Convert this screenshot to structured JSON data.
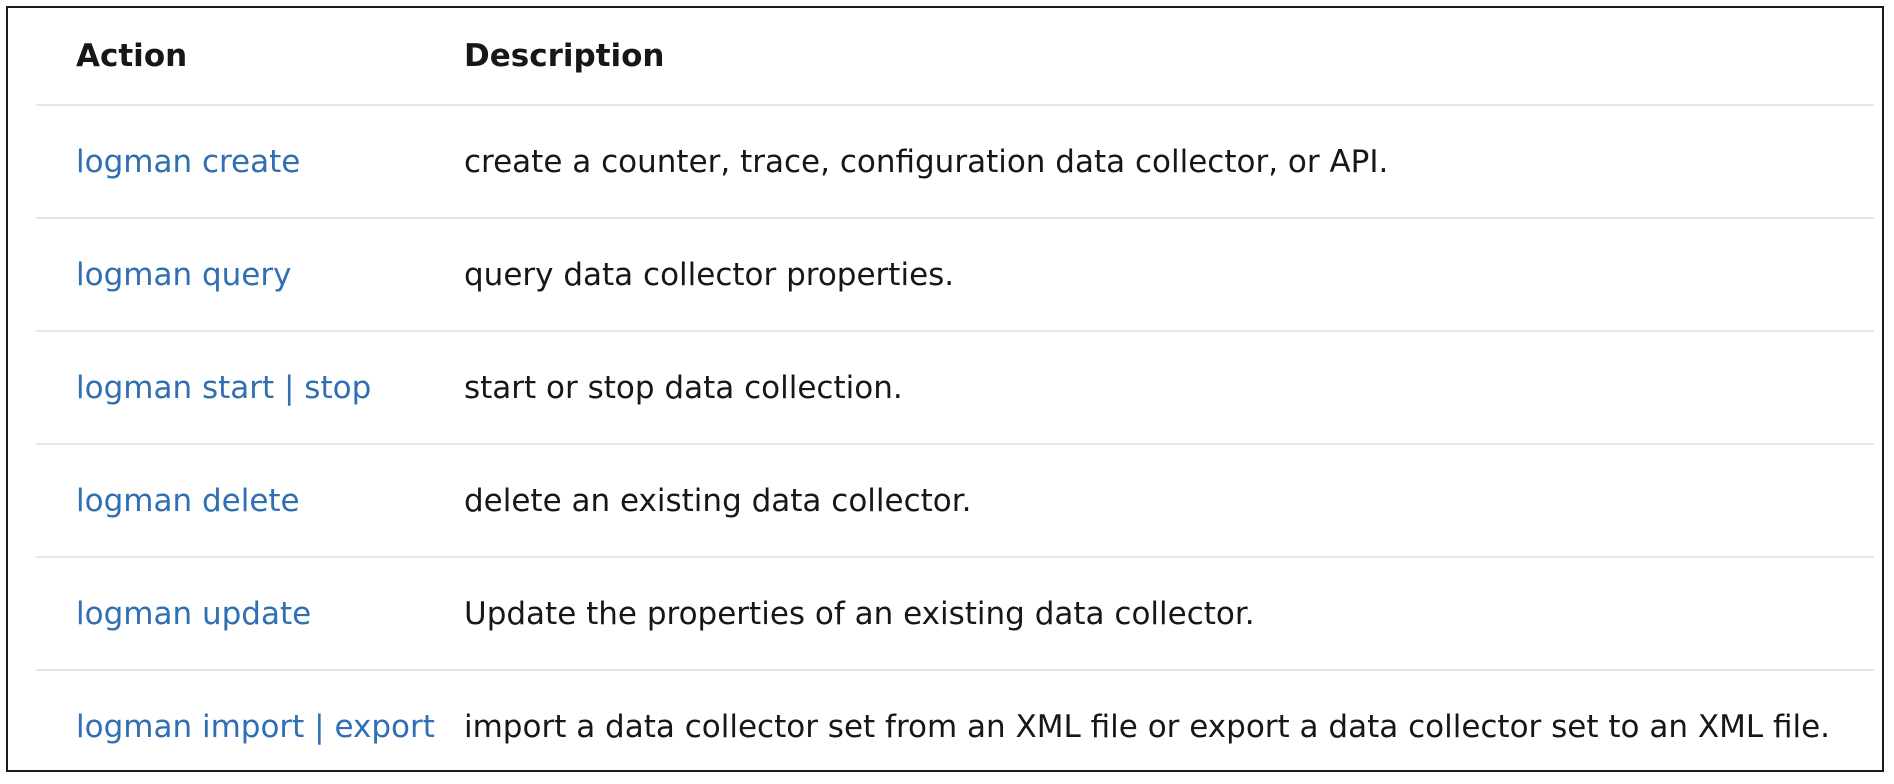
{
  "table": {
    "headers": {
      "action": "Action",
      "description": "Description"
    },
    "rows": [
      {
        "action": "logman create",
        "description": "create a counter, trace, configuration data collector, or API."
      },
      {
        "action": "logman query",
        "description": "query data collector properties."
      },
      {
        "action": "logman start | stop",
        "description": "start or stop data collection."
      },
      {
        "action": "logman delete",
        "description": "delete an existing data collector."
      },
      {
        "action": "logman update",
        "description": "Update the properties of an existing data collector."
      },
      {
        "action": "logman import | export",
        "description": "import a data collector set from an XML file or export a data collector set to an XML file."
      }
    ]
  },
  "colors": {
    "link": "#2f6fb2",
    "text": "#171717",
    "divider": "#e6e6e6",
    "border": "#1a1a1a"
  }
}
